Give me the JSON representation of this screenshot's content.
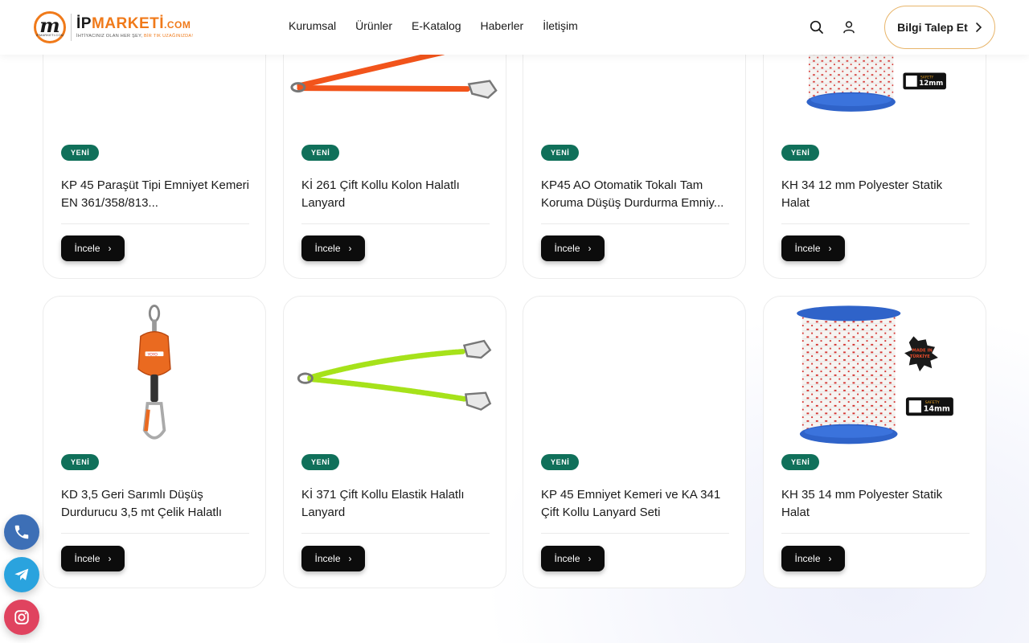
{
  "header": {
    "logo": {
      "mark_letter": "m",
      "mark_caption": "IPMARKETI.COM",
      "name_black": "İP",
      "name_orange": "MARKETİ",
      "name_suffix": ".COM",
      "slogan_black": "İHTİYACINIZ OLAN HER ŞEY,",
      "slogan_orange": "BİR TIK UZAĞINIZDA!"
    },
    "nav": [
      "Kurumsal",
      "Ürünler",
      "E-Katalog",
      "Haberler",
      "İletişim"
    ],
    "cta_label": "Bilgi Talep Et"
  },
  "products": [
    {
      "badge": "YENİ",
      "title": "KP 45 Paraşüt Tipi Emniyet Kemeri EN 361/358/813...",
      "button": "İncele",
      "image": "none"
    },
    {
      "badge": "YENİ",
      "title": "Kİ 261 Çift Kollu Kolon Halatlı Lanyard",
      "button": "İncele",
      "image": "orange-lanyard"
    },
    {
      "badge": "YENİ",
      "title": "KP45 AO Otomatik Tokalı Tam Koruma Düşüş Durdurma Emniy...",
      "button": "İncele",
      "image": "none"
    },
    {
      "badge": "YENİ",
      "title": "KH 34 12 mm Polyester Statik Halat",
      "button": "İncele",
      "image": "rope-spool"
    },
    {
      "badge": "YENİ",
      "title": "KD 3,5 Geri Sarımlı Düşüş Durdurucu 3,5 mt Çelik Halatlı",
      "button": "İncele",
      "image": "fall-arrester"
    },
    {
      "badge": "YENİ",
      "title": "Kİ 371 Çift Kollu Elastik Halatlı Lanyard",
      "button": "İncele",
      "image": "green-lanyard"
    },
    {
      "badge": "YENİ",
      "title": "KP 45 Emniyet Kemeri ve KA 341 Çift Kollu Lanyard Seti",
      "button": "İncele",
      "image": "none"
    },
    {
      "badge": "YENİ",
      "title": "KH 35 14 mm Polyester Statik Halat",
      "button": "İncele",
      "image": "rope-spool"
    }
  ],
  "spool_labels": {
    "safety": "SAFETY",
    "size_12": "12mm",
    "size_14": "14mm",
    "made_in": "MADE IN",
    "turkiye": "TÜRKİYE"
  },
  "arrester_label": "YOYO",
  "floating": {
    "phone_color": "#3d6fb6",
    "telegram_color": "#2aa3de",
    "instagram_color": "#e0435f"
  },
  "colors": {
    "badge": "#10705a",
    "brand_orange": "#f07a1a",
    "cta_border": "#e8b56a"
  }
}
